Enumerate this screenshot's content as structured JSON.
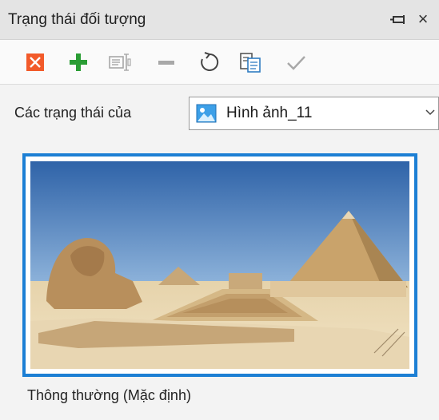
{
  "panel": {
    "title": "Trạng thái đối tượng",
    "close_glyph": "×",
    "pin_icon": "pin-icon"
  },
  "toolbar": {
    "buttons": [
      {
        "name": "delete-state-button",
        "icon": "delete-icon",
        "enabled": true
      },
      {
        "name": "add-state-button",
        "icon": "plus-icon",
        "enabled": true
      },
      {
        "name": "rename-state-button",
        "icon": "rename-icon",
        "enabled": false
      },
      {
        "name": "remove-state-button",
        "icon": "minus-icon",
        "enabled": false
      },
      {
        "name": "reset-state-button",
        "icon": "reset-icon",
        "enabled": true
      },
      {
        "name": "duplicate-state-button",
        "icon": "duplicate-icon",
        "enabled": true
      },
      {
        "name": "apply-state-button",
        "icon": "check-icon",
        "enabled": false
      }
    ]
  },
  "states_of": {
    "label": "Các trạng thái của",
    "selected": "Hình ảnh_11",
    "icon": "image-icon"
  },
  "state": {
    "label": "Thông thường (Mặc định)",
    "thumbnail_icon": "pyramids-sphinx-image"
  },
  "colors": {
    "accent": "#1c7fd4",
    "delete": "#f25a2a",
    "add": "#2a9d34",
    "disabled": "#a8a8a8"
  }
}
